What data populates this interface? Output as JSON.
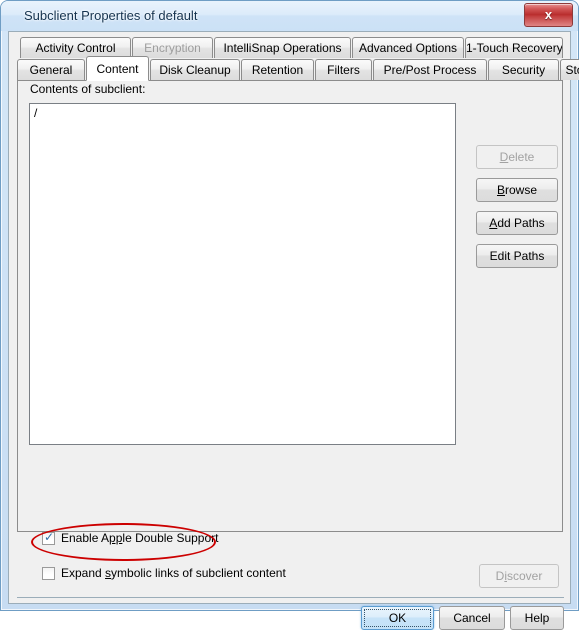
{
  "window": {
    "title": "Subclient Properties of default",
    "close_label": "x"
  },
  "tabs": {
    "row1": [
      {
        "label": "Activity Control",
        "state": "normal"
      },
      {
        "label": "Encryption",
        "state": "disabled"
      },
      {
        "label": "IntelliSnap Operations",
        "state": "normal"
      },
      {
        "label": "Advanced Options",
        "state": "normal"
      },
      {
        "label": "1-Touch Recovery",
        "state": "normal"
      }
    ],
    "row2": [
      {
        "label": "General",
        "state": "normal"
      },
      {
        "label": "Content",
        "state": "selected"
      },
      {
        "label": "Disk Cleanup",
        "state": "normal"
      },
      {
        "label": "Retention",
        "state": "normal"
      },
      {
        "label": "Filters",
        "state": "normal"
      },
      {
        "label": "Pre/Post Process",
        "state": "normal"
      },
      {
        "label": "Security",
        "state": "normal"
      },
      {
        "label": "Storage Device",
        "state": "normal"
      }
    ]
  },
  "content_tab": {
    "contents_label": "Contents of subclient:",
    "list_items": [
      "/"
    ],
    "buttons": {
      "delete": {
        "label": "Delete",
        "accel": "D",
        "enabled": false
      },
      "browse": {
        "label": "Browse",
        "accel": "B",
        "enabled": true
      },
      "add_paths": {
        "label": "Add Paths",
        "accel": "A",
        "enabled": true
      },
      "edit_paths": {
        "label": "Edit Paths",
        "accel": "",
        "enabled": true
      }
    },
    "checkboxes": {
      "apple_double": {
        "label_pre": "Enable A",
        "label_accel": "pp",
        "label_post": "le Double Support",
        "checked": true
      },
      "symbolic_links": {
        "label_pre": "Expand ",
        "label_accel": "s",
        "label_post": "ymbolic links of subclient content",
        "checked": false
      }
    },
    "discover": {
      "label": "Discover",
      "accel": "i",
      "enabled": false
    }
  },
  "footer": {
    "ok": "OK",
    "cancel": "Cancel",
    "help": "Help"
  },
  "annotation": {
    "color": "#cc0000",
    "shape": "ellipse",
    "target": "Enable Apple Double Support"
  }
}
